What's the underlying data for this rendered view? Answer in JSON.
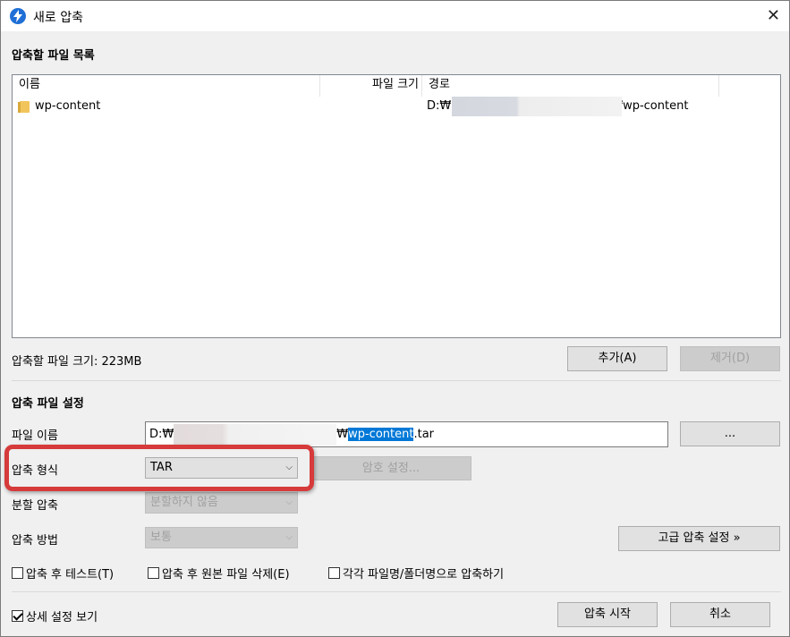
{
  "window": {
    "title": "새로 압축",
    "close": "✕"
  },
  "files_section": {
    "title": "압축할 파일 목록",
    "columns": [
      "이름",
      "파일 크기",
      "경로"
    ],
    "rows": [
      {
        "name": "wp-content",
        "size": "",
        "path_start": "D:₩",
        "path_end": "!₩wp-content"
      }
    ],
    "total_label": "압축할 파일 크기: 223MB",
    "add_button": "추가(A)",
    "remove_button": "제거(D)"
  },
  "settings": {
    "title": "압축 파일 설정",
    "filename_label": "파일 이름",
    "filename_prefix": "D:₩",
    "filename_sep": "₩",
    "filename_selected": "wp-content",
    "filename_ext": ".tar",
    "browse_button": "...",
    "format_label": "압축 형식",
    "format_value": "TAR",
    "password_button": "암호 설정...",
    "split_label": "분할 압축",
    "split_value": "분할하지 않음",
    "method_label": "압축 방법",
    "method_value": "보통",
    "advanced_button": "고급 압축 설정 »",
    "test_after": "압축 후 테스트(T)",
    "delete_after": "압축 후 원본 파일 삭제(E)",
    "each_file": "각각 파일명/폴더명으로 압축하기"
  },
  "footer": {
    "details": "상세 설정 보기",
    "start_button": "압축 시작",
    "cancel_button": "취소"
  },
  "colors": {
    "accent": "#0078d7",
    "highlight": "#d63a3a"
  }
}
